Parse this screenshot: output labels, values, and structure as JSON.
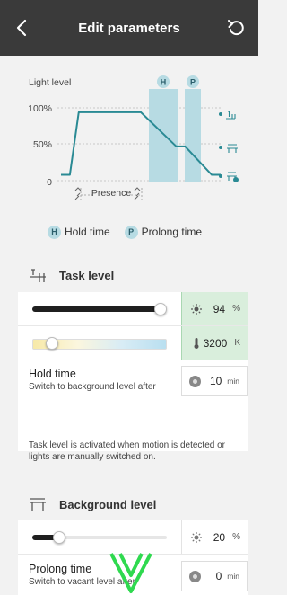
{
  "header": {
    "title": "Edit parameters",
    "back_icon": "chevron-left-icon",
    "reset_icon": "undo-icon"
  },
  "chart": {
    "ylabel": "Light level",
    "ticks": [
      "100%",
      "50%",
      "0"
    ],
    "presence_label": "Presence",
    "hold_badge": "H",
    "prolong_badge": "P",
    "line_color": "#2a8a94",
    "band_color": "#b7dbe3"
  },
  "chart_data": {
    "type": "line",
    "ylabel": "Light level",
    "yticks": [
      "100%",
      "50%",
      "0"
    ],
    "ylim": [
      0,
      100
    ],
    "series": [
      {
        "x": [
          0,
          1,
          2,
          9,
          13,
          14,
          17,
          18
        ],
        "y": [
          8,
          8,
          94,
          94,
          47,
          47,
          8,
          8
        ]
      }
    ],
    "levels": {
      "task": 94,
      "background": 47,
      "vacant": 8
    },
    "bands": [
      "H",
      "P"
    ]
  },
  "legend": {
    "hold": {
      "badge": "H",
      "label": "Hold time"
    },
    "prolong": {
      "badge": "P",
      "label": "Prolong time"
    }
  },
  "task": {
    "heading": "Task level",
    "brightness": {
      "value": "94",
      "unit": "%",
      "level": 0.94
    },
    "color_temp": {
      "value": "3200",
      "unit": "K",
      "level": 0.15
    },
    "hold": {
      "title": "Hold time",
      "subtitle": "Switch to background level after",
      "value": "10",
      "unit": "min"
    },
    "note": "Task level is activated when motion is detected or lights are manually switched on."
  },
  "background": {
    "heading": "Background level",
    "brightness": {
      "value": "20",
      "unit": "%",
      "level": 0.2
    },
    "prolong": {
      "title": "Prolong time",
      "subtitle": "Switch to vacant level after",
      "value": "0",
      "unit": "min"
    }
  },
  "overlay": {
    "icon": "scroll-down-chevron-icon",
    "color": "#2fd94f"
  }
}
